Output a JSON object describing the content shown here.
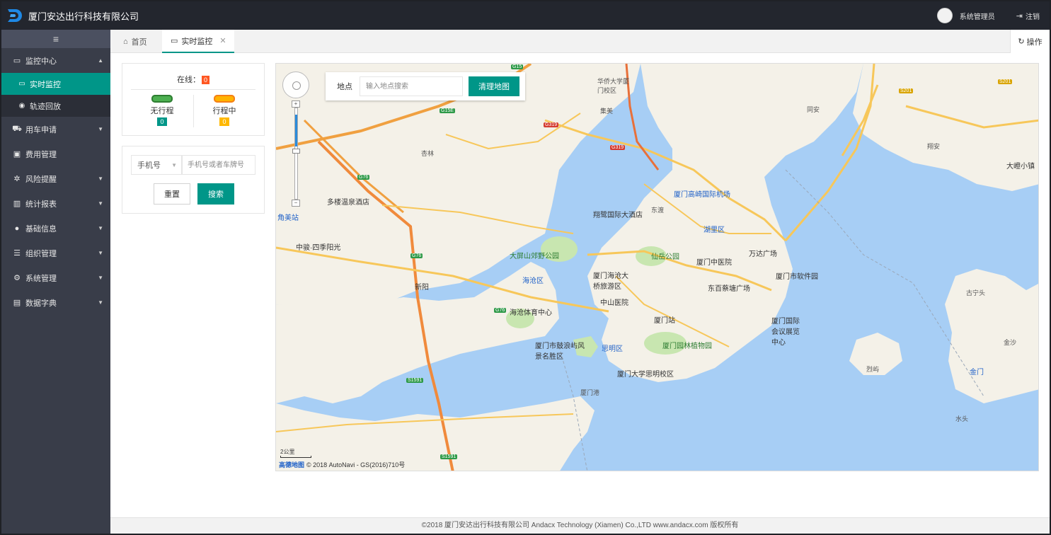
{
  "header": {
    "app_title": "厦门安达出行科技有限公司",
    "user_name": "系统管理员",
    "logout_label": "注销"
  },
  "sidebar": {
    "items": [
      {
        "label": "监控中心",
        "icon": "monitor-icon",
        "open": true,
        "children": [
          {
            "label": "实时监控",
            "icon": "monitor-icon",
            "active": true
          },
          {
            "label": "轨迹回放",
            "icon": "target-icon",
            "active": false
          }
        ]
      },
      {
        "label": "用车申请",
        "icon": "car-icon"
      },
      {
        "label": "费用管理",
        "icon": "money-icon"
      },
      {
        "label": "风险提醒",
        "icon": "alert-icon"
      },
      {
        "label": "统计报表",
        "icon": "chart-icon"
      },
      {
        "label": "基础信息",
        "icon": "info-icon"
      },
      {
        "label": "组织管理",
        "icon": "org-icon"
      },
      {
        "label": "系统管理",
        "icon": "gears-icon"
      },
      {
        "label": "数据字典",
        "icon": "book-icon"
      }
    ]
  },
  "tabs": {
    "home_label": "首页",
    "active_label": "实时监控",
    "ops_label": "操作"
  },
  "status": {
    "online_label": "在线：",
    "online_count": "0",
    "idle_label": "无行程",
    "idle_count": "0",
    "busy_label": "行程中",
    "busy_count": "0"
  },
  "search": {
    "select_value": "手机号",
    "input_placeholder": "手机号或者车牌号",
    "reset_label": "重置",
    "search_label": "搜索"
  },
  "map": {
    "search_label": "地点",
    "search_placeholder": "输入地点搜索",
    "clear_label": "清理地图",
    "scale_label": "2公里",
    "credit_brand": "高德地图",
    "credit_text": "© 2018 AutoNavi - GS(2016)710号",
    "labels": {
      "airport": "厦门高崎国际机场",
      "hotel1": "多楼温泉酒店",
      "hotel2": "翔鹭国际大酒店",
      "park1": "大屏山郊野公园",
      "park2": "仙岳公园",
      "huli": "湖里区",
      "haicang": "海沧区",
      "siming": "思明区",
      "wanda": "万达广场",
      "softpark": "厦门市软件园",
      "dongbai": "东百蔡塘广场",
      "hospital1": "厦门中医院",
      "hospital2": "中山医院",
      "station": "厦门站",
      "botanic": "厦门园林植物园",
      "gulangyu": "厦门市鼓浪屿风景名胜区",
      "xmu": "厦门大学思明校区",
      "huaqiao": "华侨大学厦门校区",
      "haicang_bridge": "厦门海沧大桥旅游区",
      "convention": "厦门国际会议展览中心",
      "dadeng": "大嶝小镇",
      "sports": "海沧体育中心",
      "jiaomei": "角美站",
      "zhongnan": "中骏·四季阳光",
      "xinyang": "新阳",
      "dongdu": "东渡",
      "xiamen_port": "厦门港",
      "jimei": "集美",
      "xinglin": "杏林",
      "tongan": "同安",
      "xiangan": "翔安",
      "jinmen": "金门",
      "shuitou": "水头",
      "guningtou": "古宁头",
      "jinsha": "金沙",
      "lieyu": "烈屿"
    },
    "roads": [
      "G15",
      "G15E",
      "G319",
      "G319",
      "G76",
      "G76",
      "G76",
      "S1591",
      "S1591",
      "S201",
      "S201"
    ]
  },
  "footer": {
    "text": "©2018 厦门安达出行科技有限公司 Andacx Technology (Xiamen) Co.,LTD www.andacx.com 版权所有"
  }
}
